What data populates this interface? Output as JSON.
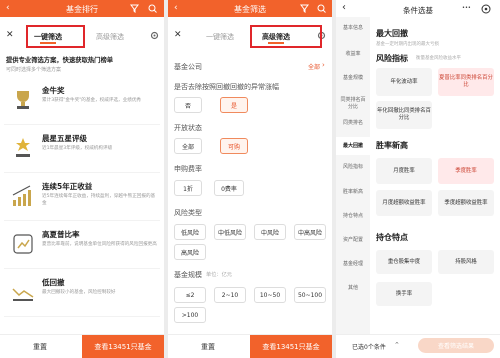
{
  "p1": {
    "title": "基金排行",
    "tab1": "一键筛选",
    "tab2": "高级筛选",
    "intro": "提供专业筛选方案，快速获取热门榜单",
    "intro_sub": "可同时选择多个筛选方案",
    "cards": [
      {
        "title": "金牛奖",
        "desc": "累计3获得\"金牛奖\"的基金，权威评选，业绩优秀"
      },
      {
        "title": "晨星五星评级",
        "desc": "近1年晨星3年评级，权威机构评级"
      },
      {
        "title": "连续5年正收益",
        "desc": "近5年连续每年正收益，持续盈利，穿越牛熊正回报的基金"
      },
      {
        "title": "高夏普比率",
        "desc": "夏普比率靠前，说明基金单位风险所获得的风险回报更高"
      },
      {
        "title": "低回撤",
        "desc": "最大回撤较小的基金，风险控制较好"
      }
    ],
    "reset": "重置",
    "view": "查看13451只基金"
  },
  "p2": {
    "title": "基金筛选",
    "tab1": "一键筛选",
    "tab2": "高级筛选",
    "company_label": "基金公司",
    "company_value": "全部",
    "excl_label": "是否去除按照回撤回撤的异常涨幅",
    "excl": [
      "否",
      "是"
    ],
    "status_label": "开放状态",
    "status": [
      "全部",
      "可购"
    ],
    "fee_label": "申购费率",
    "fee": [
      "1折",
      "0费率"
    ],
    "risk_label": "风险类型",
    "risk": [
      "低风险",
      "中低风险",
      "中风险",
      "中高风险",
      "高风险"
    ],
    "scale_label": "基金规模",
    "scale_unit": "单位：亿元",
    "scale": [
      "≤2",
      "2~10",
      "10~50",
      "50~100",
      ">100"
    ],
    "reset": "重置",
    "view": "查看13451只基金"
  },
  "p3": {
    "title": "条件选基",
    "side": [
      "基本信息",
      "收益率",
      "基金规模",
      "同类排名百分比",
      "同类排名",
      "最大回撤",
      "风险指标",
      "胜率新高",
      "持仓特点",
      "资产配置",
      "基金经理",
      "其他"
    ],
    "side_active": 5,
    "sec1": "最大回撤",
    "sec1_sub": "基金一定时期内出现的最大亏损",
    "sec2": "风险指标",
    "sec2_sub": "衡量基金风险收益水平",
    "risk_tiles": [
      "年化波动率",
      "夏普比率同类排名百分比",
      "年化回撤比同类排名百分比"
    ],
    "sec3": "胜率新高",
    "win_tiles": [
      "月度胜率",
      "季度胜率",
      "月度超额收益胜率",
      "季度超额收益胜率"
    ],
    "sec4": "持仓特点",
    "hold_tiles": [
      "重仓股集中度",
      "持股风格",
      "换手率"
    ],
    "footer": "已选0个条件",
    "confirm": "查看筛选结果"
  }
}
